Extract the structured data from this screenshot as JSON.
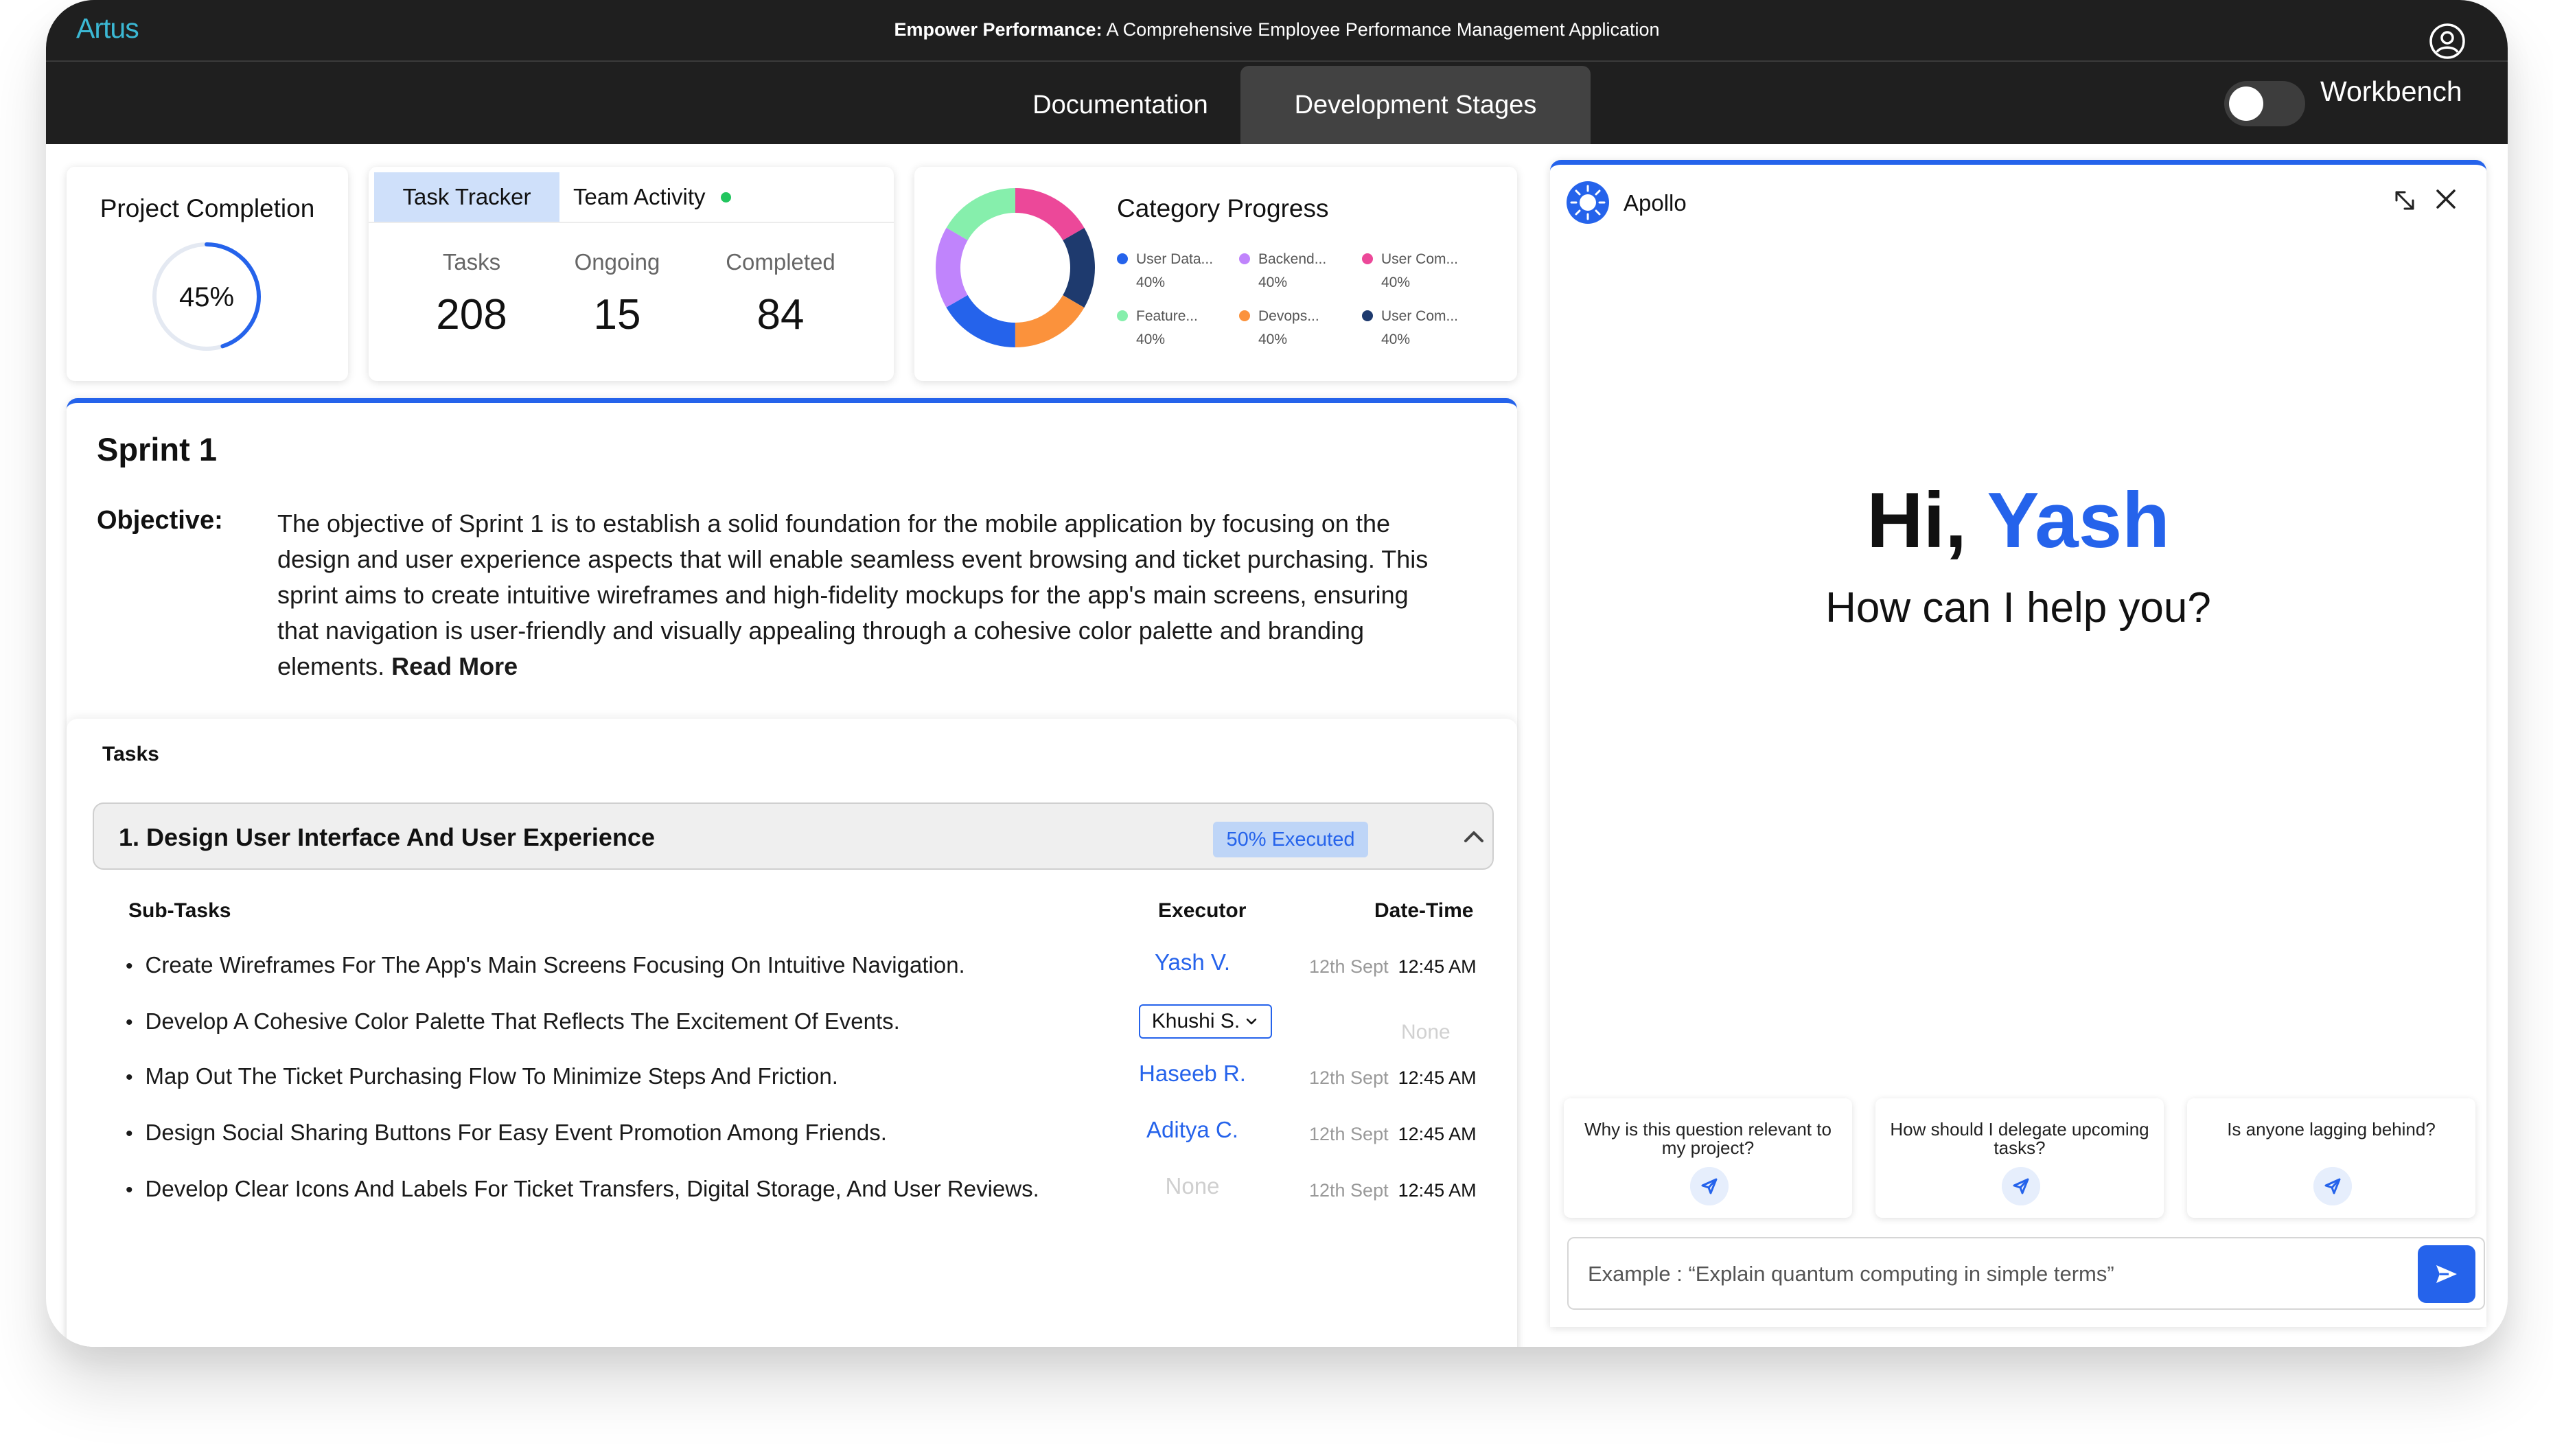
{
  "header": {
    "brand": "Artus",
    "title_bold": "Empower Performance:",
    "title_rest": " A Comprehensive Employee Performance Management Application",
    "tabs": [
      {
        "label": "Documentation"
      },
      {
        "label": "Development Stages",
        "active": true
      }
    ],
    "workbench_label": "Workbench",
    "workbench_on": false
  },
  "project_completion": {
    "title": "Project Completion",
    "percent_label": "45%",
    "percent": 45
  },
  "task_tracker": {
    "tab_active": "Task Tracker",
    "tab_other": "Team Activity",
    "stats": [
      {
        "label": "Tasks",
        "value": "208"
      },
      {
        "label": "Ongoing",
        "value": "15"
      },
      {
        "label": "Completed",
        "value": "84"
      }
    ]
  },
  "category_progress": {
    "title": "Category Progress",
    "items": [
      {
        "name": "User Data...",
        "pct": "40%",
        "color": "#2563eb"
      },
      {
        "name": "Backend...",
        "pct": "40%",
        "color": "#c084fc"
      },
      {
        "name": "User Com...",
        "pct": "40%",
        "color": "#ec4899"
      },
      {
        "name": "Feature...",
        "pct": "40%",
        "color": "#86efac"
      },
      {
        "name": "Devops...",
        "pct": "40%",
        "color": "#fb923c"
      },
      {
        "name": "User Com...",
        "pct": "40%",
        "color": "#1e3a6e"
      }
    ]
  },
  "sprint": {
    "title": "Sprint 1",
    "objective_label": "Objective:",
    "objective_text": "The objective of Sprint 1 is to establish a solid foundation for the mobile application by focusing on the design and user experience aspects that will enable seamless event browsing and ticket purchasing. This sprint aims to create intuitive wireframes and high-fidelity mockups for the app's main screens, ensuring that navigation is user-friendly and visually appealing through a cohesive color palette and branding elements.",
    "read_more": "Read More",
    "tasks_label": "Tasks",
    "task": {
      "title": "1. Design User Interface And User Experience",
      "badge": "50% Executed",
      "headers": {
        "subtasks": "Sub-Tasks",
        "executor": "Executor",
        "datetime": "Date-Time"
      },
      "subtasks": [
        {
          "text": "Create Wireframes For The App's Main Screens Focusing On Intuitive Navigation.",
          "executor": "Yash V.",
          "date": "12th Sept",
          "time": "12:45 AM"
        },
        {
          "text": "Develop A Cohesive Color Palette That Reflects The Excitement Of Events.",
          "executor": "Khushi S.",
          "date": "None",
          "time": ""
        },
        {
          "text": "Map Out The Ticket Purchasing Flow To Minimize Steps And Friction.",
          "executor": "Haseeb R.",
          "date": "12th Sept",
          "time": "12:45 AM"
        },
        {
          "text": "Design Social Sharing Buttons For Easy Event Promotion Among Friends.",
          "executor": "Aditya C.",
          "date": "12th Sept",
          "time": "12:45 AM"
        },
        {
          "text": "Develop Clear Icons And Labels For Ticket Transfers, Digital Storage, And User Reviews.",
          "executor": "None",
          "date": "12th Sept",
          "time": "12:45 AM"
        }
      ]
    }
  },
  "apollo": {
    "name": "Apollo",
    "greeting_prefix": "Hi, ",
    "greeting_name": "Yash",
    "subheading": "How can I help you?",
    "suggestions": [
      {
        "text": "Why is this question relevant to my project?"
      },
      {
        "text": "How should I delegate upcoming tasks?"
      },
      {
        "text": "Is anyone lagging behind?"
      }
    ],
    "input_placeholder": "Example : “Explain quantum computing in simple terms”",
    "input_value": ""
  }
}
